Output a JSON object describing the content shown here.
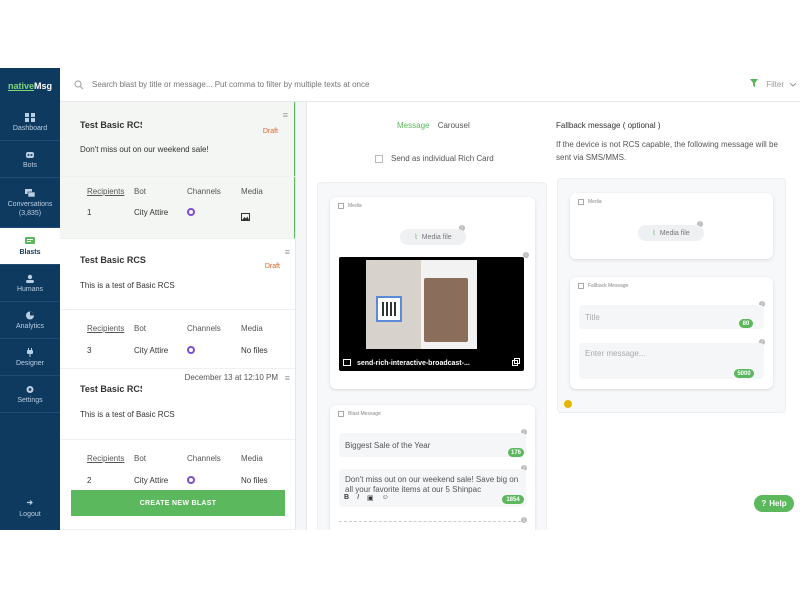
{
  "app": {
    "logo_part1": "native",
    "logo_part2": "Msg"
  },
  "sidebar": {
    "items": [
      {
        "label": "Dashboard"
      },
      {
        "label": "Bots"
      },
      {
        "label": "Conversations",
        "sub": "(3,835)"
      },
      {
        "label": "Blasts"
      },
      {
        "label": "Humans"
      },
      {
        "label": "Analytics"
      },
      {
        "label": "Designer"
      },
      {
        "label": "Settings"
      }
    ],
    "logout": "Logout"
  },
  "topbar": {
    "search_placeholder": "Search blast by title or message... Put comma to filter by multiple texts at once",
    "filter_label": "Filter"
  },
  "blasts": [
    {
      "title": "Test Basic RCS",
      "status": "Draft",
      "date": "",
      "message": "Don't miss out on our weekend sale!",
      "headers": [
        "Recipients",
        "Bot",
        "Channels",
        "Media"
      ],
      "recipients": "1",
      "bot": "City Attire",
      "media": ""
    },
    {
      "title": "Test Basic RCS",
      "status": "Draft",
      "date": "",
      "message": "This is a test of Basic RCS",
      "headers": [
        "Recipients",
        "Bot",
        "Channels",
        "Media"
      ],
      "recipients": "3",
      "bot": "City Attire",
      "media": "No files"
    },
    {
      "title": "Test Basic RCS",
      "status": "",
      "date": "December 13 at 12:10 PM",
      "message": "This is a test of Basic RCS",
      "headers": [
        "Recipients",
        "Bot",
        "Channels",
        "Media"
      ],
      "recipients": "2",
      "bot": "City Attire",
      "media": "No files"
    }
  ],
  "create_button": "CREATE NEW BLAST",
  "editor": {
    "tab_message": "Message",
    "tab_carousel": "Carousel",
    "rich_card_label": "Send as individual Rich Card",
    "media_header": "Media",
    "media_button": "Media file",
    "preview_caption": "send-rich-interactive-broadcast-...",
    "blast_header": "Blast Message",
    "title_value": "Biggest Sale of the Year",
    "title_count": "176",
    "message_value": "Don't miss out on our weekend sale! Save big on all your favorite items at our 5 Shinpac",
    "message_count": "1854"
  },
  "fallback": {
    "title": "Fallback message ( optional )",
    "desc": "If the device is not RCS capable, the following message will be sent via SMS/MMS.",
    "media_header": "Media",
    "media_button": "Media file",
    "message_header": "Fallback Message",
    "title_placeholder": "Title",
    "title_count": "80",
    "message_placeholder": "Enter message...",
    "message_count": "5000"
  },
  "help": "Help",
  "colors": {
    "sidebar": "#0f3a5f",
    "accent": "#5cb85c",
    "draft": "#e0632a",
    "channel": "#7b4fd6"
  }
}
